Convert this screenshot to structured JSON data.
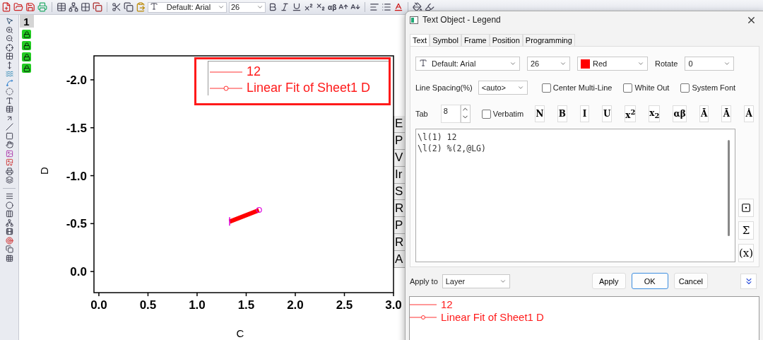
{
  "toolbar": {
    "font": "Default: Arial",
    "size": "26",
    "greek": "αβ"
  },
  "layer_panel": {
    "number": "1"
  },
  "graph": {
    "chart_data": {
      "type": "line",
      "xlabel": "C",
      "ylabel": "D",
      "x": [
        1.33,
        1.63
      ],
      "series": [
        {
          "name": "Linear Fit of Sheet1 D",
          "color": "#ff0000",
          "values": [
            -0.52,
            -0.64
          ]
        }
      ],
      "xlim": [
        -0.05,
        3.0
      ],
      "ylim": [
        0.22,
        -2.25
      ],
      "xticks": [
        {
          "value": 0,
          "label": "0.0"
        },
        {
          "value": 0.5,
          "label": "0.5"
        },
        {
          "value": 1,
          "label": "1.0"
        },
        {
          "value": 1.5,
          "label": "1.5"
        },
        {
          "value": 2,
          "label": "2.0"
        },
        {
          "value": 2.5,
          "label": "2.5"
        },
        {
          "value": 3,
          "label": "3.0"
        }
      ],
      "yticks": [
        {
          "value": -2,
          "label": "-2.0"
        },
        {
          "value": -1.5,
          "label": "-1.5"
        },
        {
          "value": -1,
          "label": "-1.0"
        },
        {
          "value": -0.5,
          "label": "-0.5"
        },
        {
          "value": 0,
          "label": "0.0"
        }
      ]
    },
    "legend": [
      {
        "label": "12",
        "kind": "line"
      }
    ],
    "selected": true,
    "side_tabs": [
      "E",
      "P",
      "V",
      "Ir",
      "S",
      "R",
      "P",
      "R",
      "A"
    ]
  },
  "dialog": {
    "title": "Text Object - Legend",
    "tabs": [
      {
        "label": "Text",
        "selected": true
      },
      {
        "label": "Symbol",
        "selected": false
      },
      {
        "label": "Frame",
        "selected": false
      },
      {
        "label": "Position",
        "selected": false
      },
      {
        "label": "Programming",
        "selected": false
      }
    ],
    "font": "Default: Arial",
    "size": "26",
    "color": {
      "label": "Red",
      "color": "#ff0000"
    },
    "rotate_label": "Rotate",
    "rotate": "0",
    "line_spacing_label": "Line Spacing(%)",
    "line_spacing": "<auto>",
    "options": [
      {
        "label": "Center Multi-Line",
        "checked": false
      },
      {
        "label": "White Out",
        "checked": false
      },
      {
        "label": "System Font",
        "checked": false
      }
    ],
    "tab_label": "Tab",
    "tab": "8",
    "verbatim": {
      "label": "Verbatim",
      "checked": false
    },
    "format_buttons": [
      "N",
      "B",
      "I",
      "U",
      "x$^{2}$",
      "x$_{2}$",
      "αβ",
      "Ā",
      "Ã",
      "Ȧ"
    ],
    "text_lines": [
      "\\l(1) 12",
      "\\l(2) %(2,@LG)"
    ],
    "side_buttons": [
      "Σ",
      "(x)"
    ],
    "apply_to_label": "Apply to",
    "apply_to": "Layer",
    "buttons": [
      {
        "label": "Apply",
        "default": false
      },
      {
        "label": "OK",
        "default": true
      },
      {
        "label": "Cancel",
        "default": false
      }
    ],
    "preview": [
      {
        "label": "12",
        "kind": "line"
      },
      {
        "label": "Linear Fit of Sheet1 D",
        "kind": "line-symbol"
      }
    ]
  }
}
